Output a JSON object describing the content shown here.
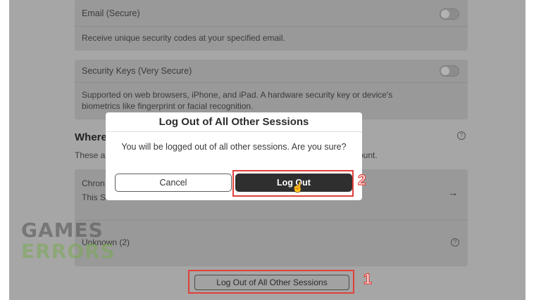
{
  "settings": {
    "email_card": {
      "title": "Email (Secure)",
      "description": "Receive unique security codes at your specified email.",
      "toggle_on": false
    },
    "security_keys_card": {
      "title": "Security Keys (Very Secure)",
      "description_line1": "Supported on web browsers, iPhone, and iPad. A hardware security key or device's",
      "description_line2": "biometrics like fingerprint or facial recognition.",
      "toggle_on": false
    },
    "sessions_section": {
      "heading_visible": "Where",
      "subtitle_start": "These a",
      "subtitle_end": "ount.",
      "help_icon": "?",
      "session_name": "Chron",
      "session_sub": "This S",
      "arrow_icon": "→",
      "unknown_label": "Unknown (2)",
      "unknown_help_icon": "?"
    },
    "logout_all_button": "Log Out of All Other Sessions"
  },
  "modal": {
    "title": "Log Out of All Other Sessions",
    "message": "You will be logged out of all other sessions. Are you sure?",
    "cancel_label": "Cancel",
    "confirm_label": "Log Out"
  },
  "annotations": {
    "step1": "1",
    "step2": "2",
    "highlight_color": "#e0403a"
  },
  "watermark": {
    "line1": "GAMES",
    "line2": "ERRORS"
  }
}
